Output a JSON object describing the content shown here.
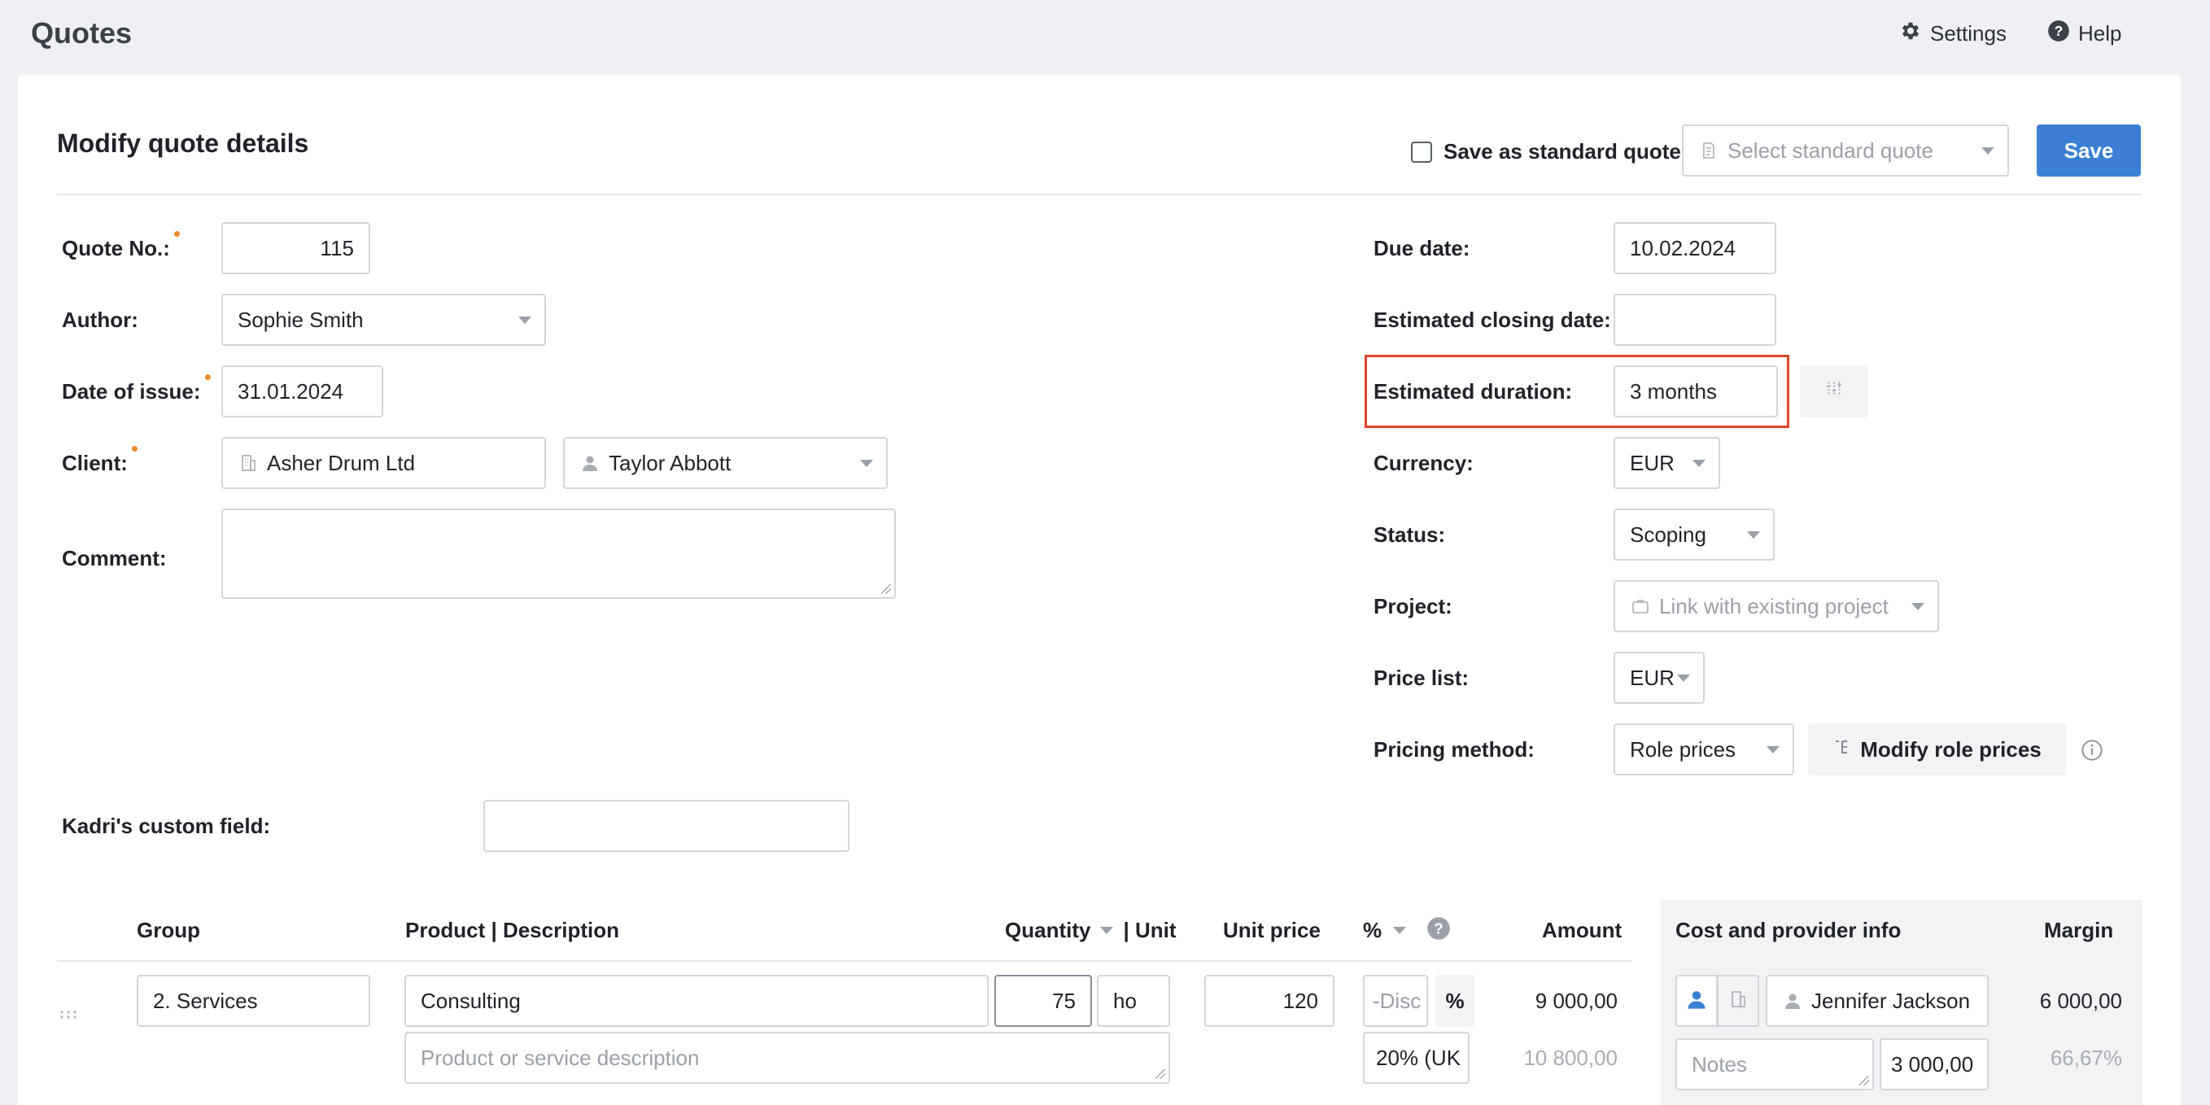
{
  "header": {
    "title": "Quotes",
    "settings_label": "Settings",
    "help_label": "Help"
  },
  "form": {
    "title": "Modify quote details",
    "save_standard_label": "Save as standard quote",
    "select_standard_placeholder": "Select standard quote",
    "save_label": "Save"
  },
  "left_fields": {
    "quote_no_label": "Quote No.:",
    "quote_no_value": "115",
    "author_label": "Author:",
    "author_value": "Sophie Smith",
    "date_issue_label": "Date of issue:",
    "date_issue_value": "31.01.2024",
    "client_label": "Client:",
    "client_company": "Asher Drum Ltd",
    "client_contact": "Taylor Abbott",
    "comment_label": "Comment:",
    "comment_value": "",
    "custom_label": "Kadri's custom field:",
    "custom_value": ""
  },
  "right_fields": {
    "due_date_label": "Due date:",
    "due_date_value": "10.02.2024",
    "closing_label": "Estimated closing date:",
    "closing_value": "",
    "duration_label": "Estimated duration:",
    "duration_value": "3 months",
    "currency_label": "Currency:",
    "currency_value": "EUR",
    "status_label": "Status:",
    "status_value": "Scoping",
    "project_label": "Project:",
    "project_placeholder": "Link with existing project",
    "price_list_label": "Price list:",
    "price_list_value": "EUR",
    "pricing_label": "Pricing method:",
    "pricing_value": "Role prices",
    "modify_role_prices_label": "Modify role prices"
  },
  "table": {
    "headers": {
      "group": "Group",
      "product": "Product | Description",
      "quantity": "Quantity",
      "unit": "| Unit",
      "unit_price": "Unit price",
      "percent": "%",
      "amount": "Amount",
      "cost_info": "Cost and provider info",
      "margin": "Margin"
    },
    "row": {
      "group": "2. Services",
      "product": "Consulting",
      "description_placeholder": "Product or service description",
      "quantity": "75",
      "unit": "ho",
      "unit_price": "120",
      "discount_placeholder": "-Disc",
      "discount_unit": "%",
      "vat": "20% (UK",
      "amount": "9 000,00",
      "amount_with_vat": "10 800,00",
      "provider": "Jennifer Jackson",
      "notes_placeholder": "Notes",
      "cost": "3 000,00",
      "margin": "6 000,00",
      "margin_percent": "66,67%"
    }
  },
  "colors": {
    "accent": "#3a7fd5",
    "highlight": "#e0442a",
    "required_dot": "#f08a2b"
  }
}
